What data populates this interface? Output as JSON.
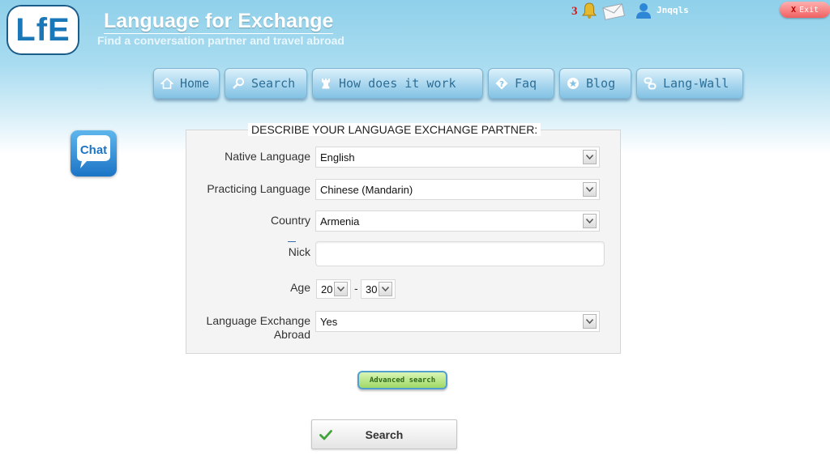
{
  "header": {
    "logo_text": "LfE",
    "title": "Language for Exchange",
    "tagline": "Find a conversation partner and travel abroad",
    "notification_count": "3",
    "username": "Jnqqls",
    "exit_label": "Exit"
  },
  "nav": {
    "items": [
      {
        "label": "Home",
        "icon": "home-icon"
      },
      {
        "label": "Search",
        "icon": "search-icon"
      },
      {
        "label": "How does it work",
        "icon": "chess-rook-icon"
      },
      {
        "label": "Faq",
        "icon": "question-icon"
      },
      {
        "label": "Blog",
        "icon": "star-icon"
      },
      {
        "label": "Lang-Wall",
        "icon": "link-icon"
      }
    ]
  },
  "chat": {
    "label": "Chat"
  },
  "form": {
    "legend": "DESCRIBE YOUR LANGUAGE EXCHANGE PARTNER:",
    "native_language": {
      "label": "Native Language",
      "value": "English"
    },
    "practicing_language": {
      "label": "Practicing Language",
      "value": "Chinese (Mandarin)"
    },
    "country": {
      "label": "Country",
      "value": "Armenia"
    },
    "nick": {
      "label": "Nick",
      "value": ""
    },
    "age": {
      "label": "Age",
      "from": "20",
      "to": "30",
      "separator": "-"
    },
    "abroad": {
      "label_line1": "Language Exchange",
      "label_line2": "Abroad",
      "value": "Yes"
    }
  },
  "buttons": {
    "advanced_search": "Advanced search",
    "search": "Search"
  },
  "colors": {
    "nav_text": "#2d6f97",
    "notification": "#d01818",
    "accent_green": "#9fd965"
  }
}
